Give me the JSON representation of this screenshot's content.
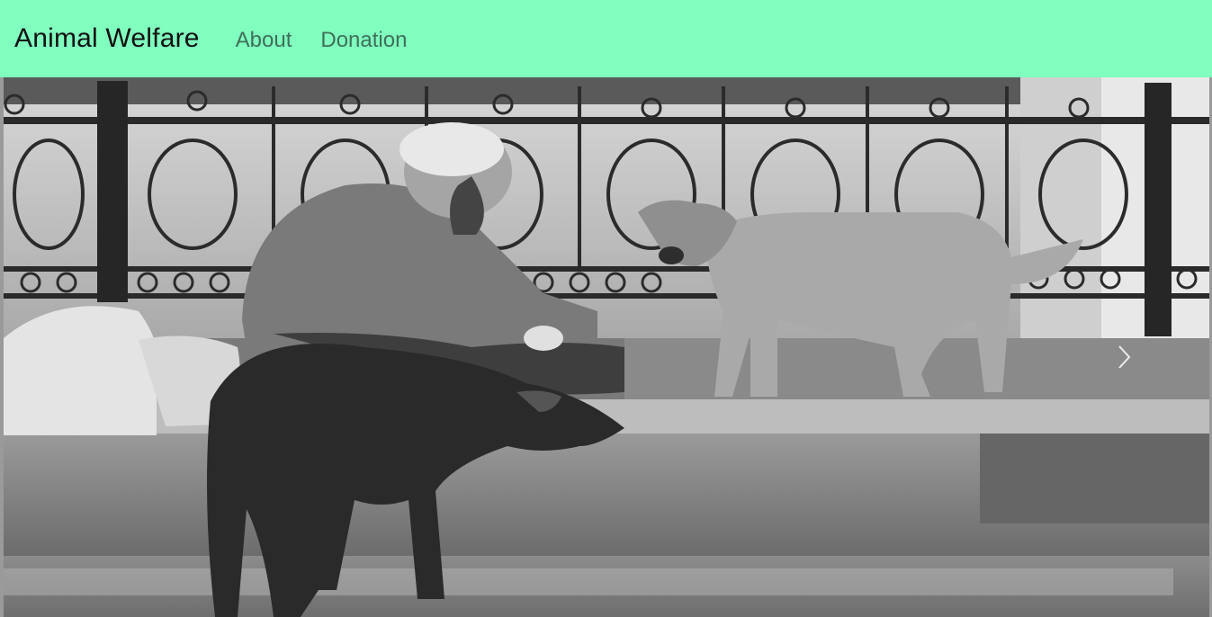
{
  "navbar": {
    "brand": "Animal Welfare",
    "links": [
      "About",
      "Donation"
    ],
    "background_color": "#80ffbf"
  },
  "carousel": {
    "image_description_icon": "photo-elderly-man-feeding-stray-dogs",
    "controls": {
      "next_icon": "chevron-right-icon"
    }
  }
}
